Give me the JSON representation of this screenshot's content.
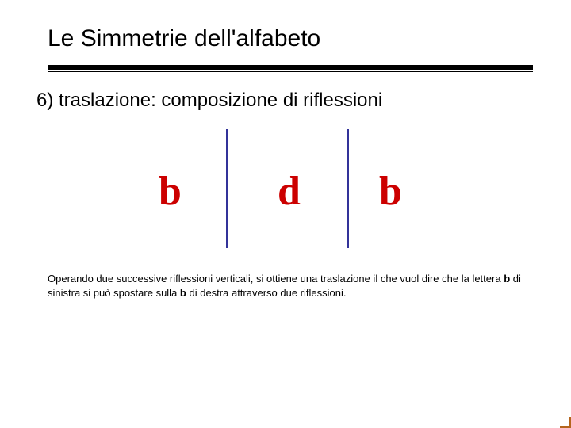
{
  "title": "Le Simmetrie dell'alfabeto",
  "subtitle": "6) traslazione: composizione di riflessioni",
  "diagram": {
    "letters": {
      "b1": "b",
      "d": "d",
      "b2": "b"
    }
  },
  "caption": {
    "part1": "Operando due successive riflessioni verticali, si ottiene una traslazione il che vuol dire che la lettera ",
    "bold1": "b",
    "part2": " di sinistra si può spostare sulla ",
    "bold2": "b",
    "part3": " di destra attraverso due riflessioni."
  }
}
